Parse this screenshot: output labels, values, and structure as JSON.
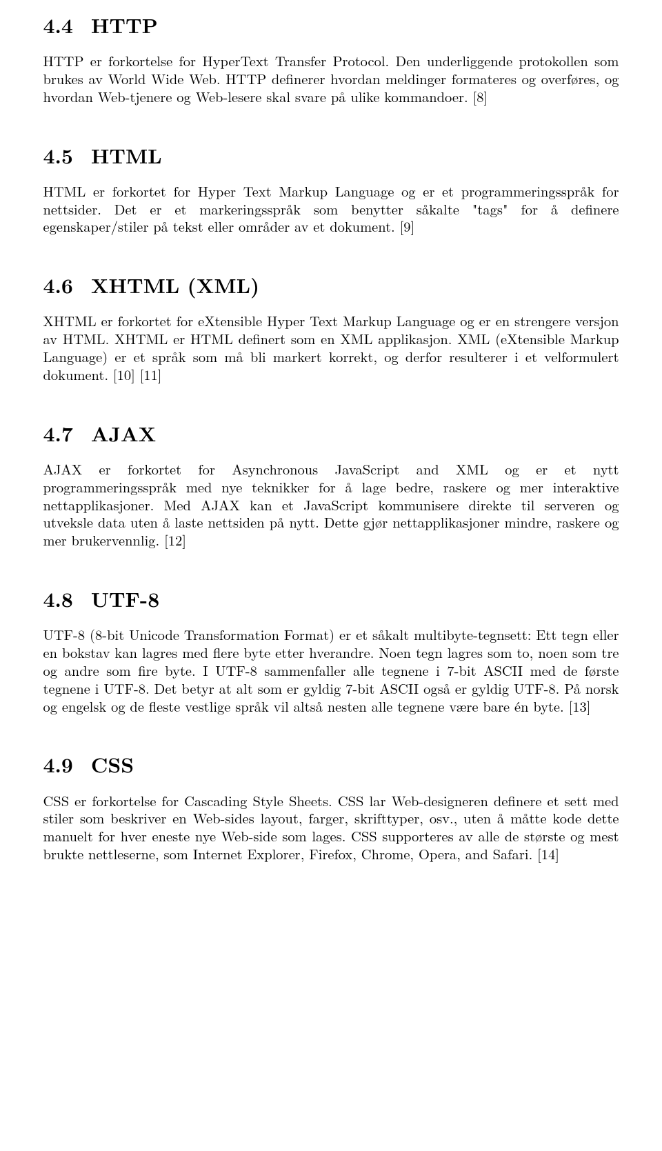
{
  "sections": [
    {
      "num": "4.4",
      "title": "HTTP",
      "body": "HTTP er forkortelse for HyperText Transfer Protocol. Den underliggende protokollen som brukes av World Wide Web. HTTP definerer hvordan meldinger formateres og overføres, og hvordan Web-tjenere og Web-lesere skal svare på ulike kommandoer. [8]"
    },
    {
      "num": "4.5",
      "title": "HTML",
      "body": "HTML er forkortet for Hyper Text Markup Language og er et programmeringsspråk for nettsider. Det er et markeringsspråk som benytter såkalte \"tags\" for å definere egenskaper/stiler på tekst eller områder av et dokument. [9]"
    },
    {
      "num": "4.6",
      "title": "XHTML (XML)",
      "body": "XHTML er forkortet for eXtensible Hyper Text Markup Language og er en strengere versjon av HTML. XHTML er HTML definert som en XML applikasjon. XML (eXtensible Markup Language) er et språk som må bli markert korrekt, og derfor resulterer i et velformulert dokument. [10] [11]"
    },
    {
      "num": "4.7",
      "title": "AJAX",
      "body": "AJAX er forkortet for Asynchronous JavaScript and XML og er et nytt programmeringsspråk med nye teknikker for å lage bedre, raskere og mer interaktive nettapplikasjoner. Med AJAX kan et JavaScript kommunisere direkte til serveren og utveksle data uten å laste nettsiden på nytt. Dette gjør nettapplikasjoner mindre, raskere og mer brukervennlig. [12]"
    },
    {
      "num": "4.8",
      "title": "UTF-8",
      "body": "UTF-8 (8-bit Unicode Transformation Format) er et såkalt multibyte-tegnsett: Ett tegn eller en bokstav kan lagres med flere byte etter hverandre. Noen tegn lagres som to, noen som tre og andre som fire byte. I UTF-8 sammenfaller alle tegnene i 7-bit ASCII med de første tegnene i UTF-8. Det betyr at alt som er gyldig 7-bit ASCII også er gyldig UTF-8. På norsk og engelsk og de fleste vestlige språk vil altså nesten alle tegnene være bare én byte. [13]"
    },
    {
      "num": "4.9",
      "title": "CSS",
      "body": "CSS er forkortelse for Cascading Style Sheets. CSS lar Web-designeren definere et sett med stiler som beskriver en Web-sides layout, farger, skrifttyper, osv., uten å måtte kode dette manuelt for hver eneste nye Web-side som lages. CSS supporteres av alle de største og mest brukte nettleserne, som Internet Explorer, Firefox, Chrome, Opera, and Safari. [14]"
    }
  ]
}
